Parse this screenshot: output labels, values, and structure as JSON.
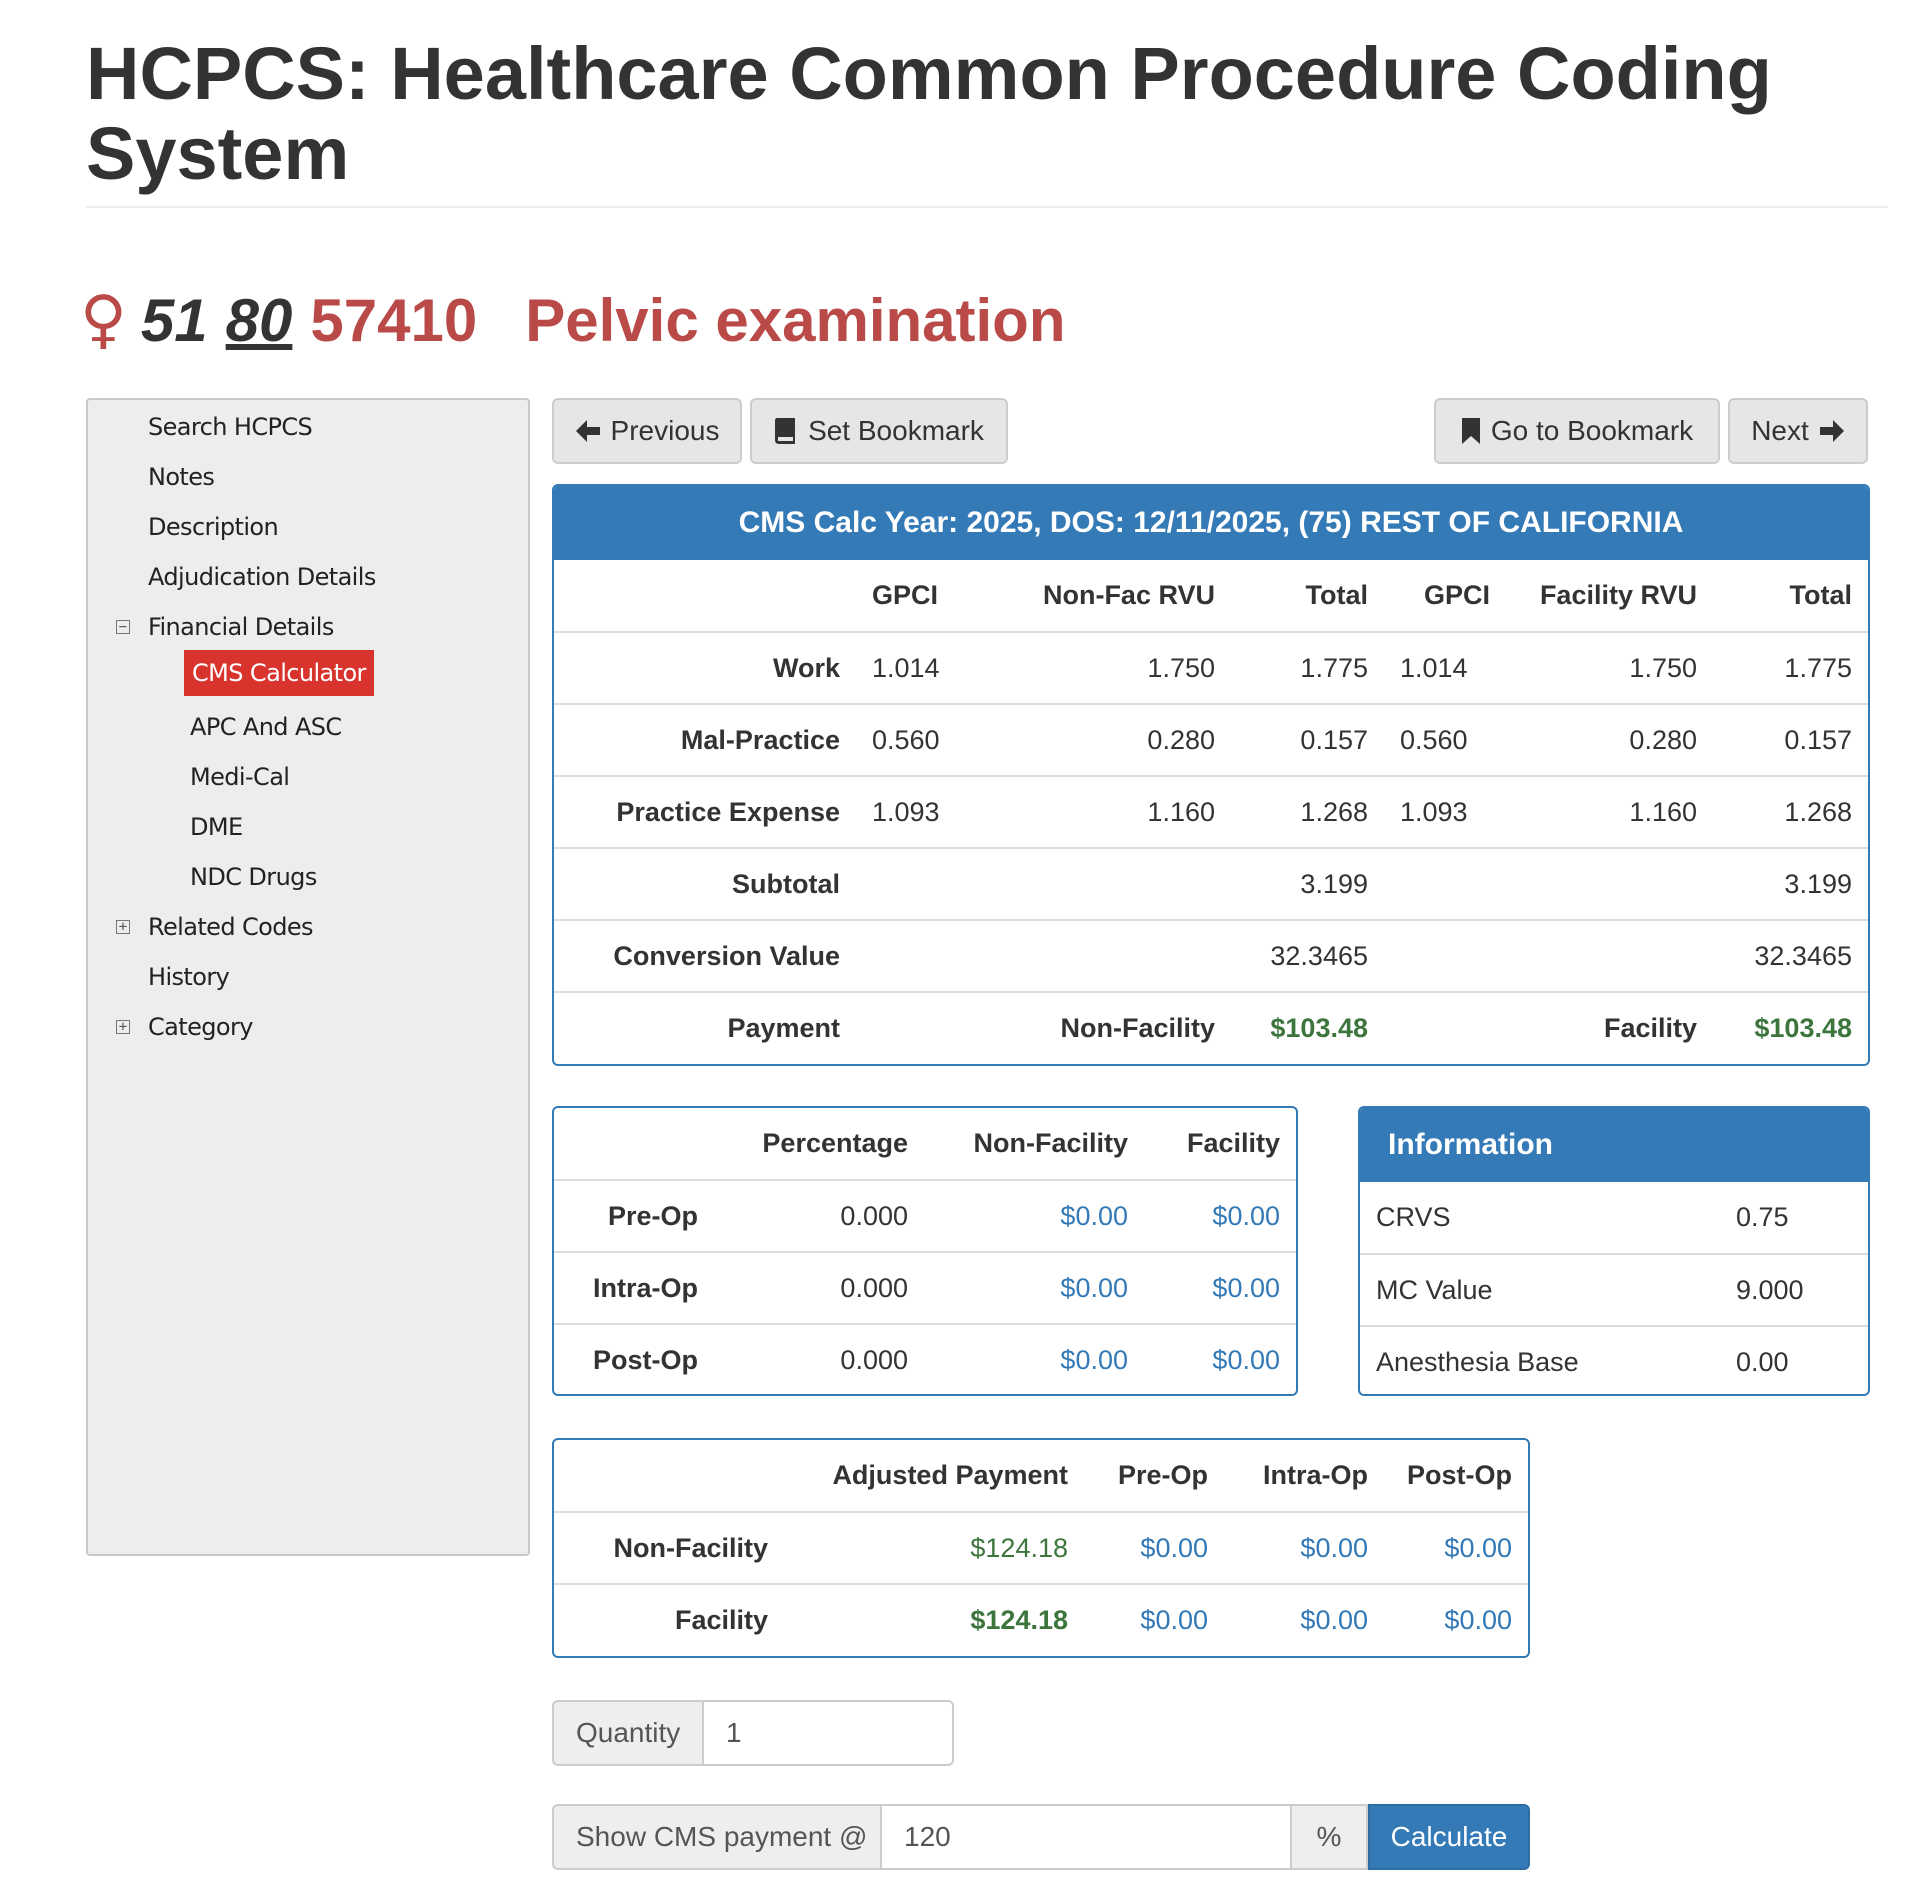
{
  "page_title": "HCPCS: Healthcare Common Procedure Coding System",
  "code_header": {
    "gender_symbol": "♀",
    "modifier1": "51",
    "modifier2": "80",
    "code": "57410",
    "description": "Pelvic examination"
  },
  "sidebar": {
    "items": [
      {
        "label": "Search HCPCS"
      },
      {
        "label": "Notes"
      },
      {
        "label": "Description"
      },
      {
        "label": "Adjudication Details"
      },
      {
        "label": "Financial Details",
        "toggle": "−"
      },
      {
        "label": "CMS Calculator",
        "active": true
      },
      {
        "label": "APC And ASC"
      },
      {
        "label": "Medi-Cal"
      },
      {
        "label": "DME"
      },
      {
        "label": "NDC Drugs"
      },
      {
        "label": "Related Codes",
        "toggle": "+"
      },
      {
        "label": "History"
      },
      {
        "label": "Category",
        "toggle": "+"
      }
    ]
  },
  "toolbar": {
    "previous": "Previous",
    "set_bookmark": "Set Bookmark",
    "go_to_bookmark": "Go to Bookmark",
    "next": "Next"
  },
  "calc_panel": {
    "heading": "CMS Calc Year: 2025, DOS: 12/11/2025, (75) REST OF CALIFORNIA",
    "columns": [
      "GPCI",
      "Non-Fac RVU",
      "Total",
      "GPCI",
      "Facility RVU",
      "Total"
    ],
    "rows": [
      {
        "label": "Work",
        "values": [
          "1.014",
          "1.750",
          "1.775",
          "1.014",
          "1.750",
          "1.775"
        ]
      },
      {
        "label": "Mal-Practice",
        "values": [
          "0.560",
          "0.280",
          "0.157",
          "0.560",
          "0.280",
          "0.157"
        ]
      },
      {
        "label": "Practice Expense",
        "values": [
          "1.093",
          "1.160",
          "1.268",
          "1.093",
          "1.160",
          "1.268"
        ]
      },
      {
        "label": "Subtotal",
        "values": [
          "",
          "",
          "3.199",
          "",
          "",
          "3.199"
        ]
      },
      {
        "label": "Conversion Value",
        "values": [
          "",
          "",
          "32.3465",
          "",
          "",
          "32.3465"
        ]
      }
    ],
    "payment": {
      "label": "Payment",
      "nonfac_label": "Non-Facility",
      "nonfac_value": "$103.48",
      "fac_label": "Facility",
      "fac_value": "$103.48"
    }
  },
  "periop_panel": {
    "columns": [
      "Percentage",
      "Non-Facility",
      "Facility"
    ],
    "rows": [
      {
        "label": "Pre-Op",
        "values": [
          "0.000",
          "$0.00",
          "$0.00"
        ]
      },
      {
        "label": "Intra-Op",
        "values": [
          "0.000",
          "$0.00",
          "$0.00"
        ]
      },
      {
        "label": "Post-Op",
        "values": [
          "0.000",
          "$0.00",
          "$0.00"
        ]
      }
    ]
  },
  "info_panel": {
    "heading": "Information",
    "rows": [
      {
        "label": "CRVS",
        "value": "0.75"
      },
      {
        "label": "MC Value",
        "value": "9.000"
      },
      {
        "label": "Anesthesia Base",
        "value": "0.00"
      }
    ]
  },
  "adjusted_panel": {
    "columns": [
      "Adjusted Payment",
      "Pre-Op",
      "Intra-Op",
      "Post-Op"
    ],
    "rows": [
      {
        "label": "Non-Facility",
        "values": [
          "$124.18",
          "$0.00",
          "$0.00",
          "$0.00"
        ]
      },
      {
        "label": "Facility",
        "values": [
          "$124.18",
          "$0.00",
          "$0.00",
          "$0.00"
        ]
      }
    ]
  },
  "quantity": {
    "label": "Quantity",
    "value": "1"
  },
  "cms_payment": {
    "label": "Show CMS payment @",
    "value": "120",
    "unit": "%",
    "button": "Calculate"
  },
  "colors": {
    "brand_blue": "#337ab7",
    "accent_red": "#b94a48",
    "active_red": "#d9332e",
    "money_green": "#3c763d"
  }
}
